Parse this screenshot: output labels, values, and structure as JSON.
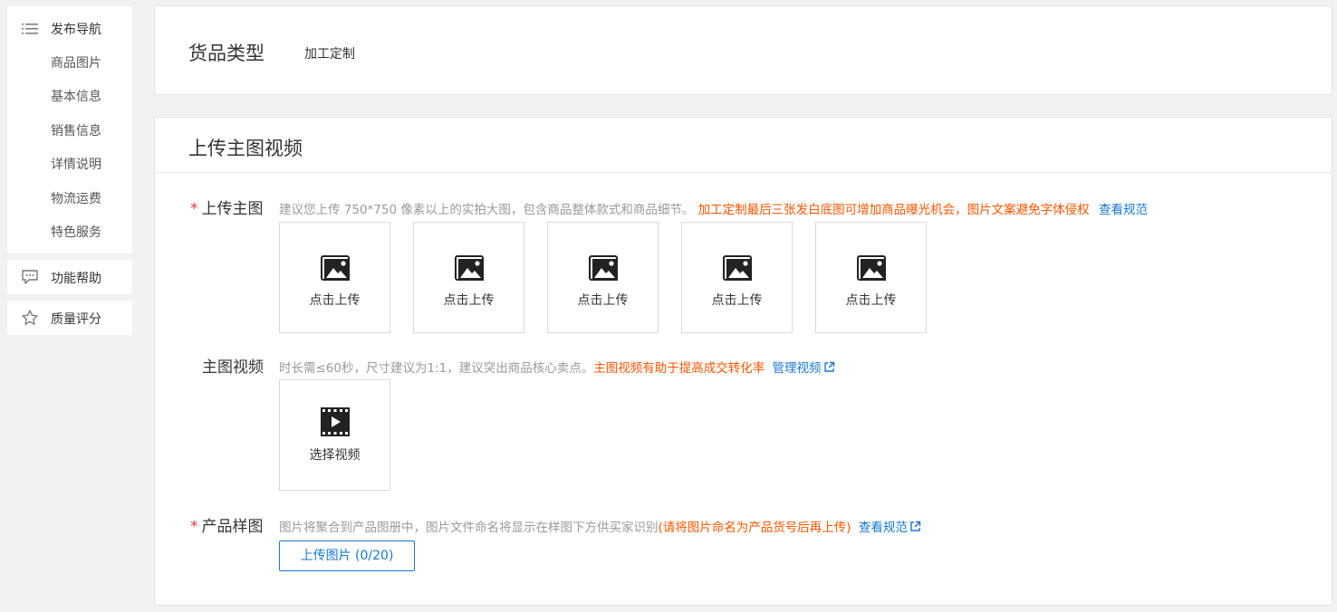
{
  "sidebar": {
    "nav_title": "发布导航",
    "nav_items": [
      {
        "label": "商品图片"
      },
      {
        "label": "基本信息"
      },
      {
        "label": "销售信息"
      },
      {
        "label": "详情说明"
      },
      {
        "label": "物流运费"
      },
      {
        "label": "特色服务"
      }
    ],
    "help_label": "功能帮助",
    "quality_label": "质量评分"
  },
  "goods_type": {
    "title": "货品类型",
    "value": "加工定制"
  },
  "media": {
    "title": "上传主图视频",
    "main_image": {
      "required_mark": "*",
      "label": "上传主图",
      "hint": "建议您上传 750*750 像素以上的实拍大图，包含商品整体款式和商品细节。",
      "warning": "加工定制最后三张发白底图可增加商品曝光机会，图片文案避免字体侵权",
      "link": "查看规范",
      "slots": [
        {
          "label": "点击上传"
        },
        {
          "label": "点击上传"
        },
        {
          "label": "点击上传"
        },
        {
          "label": "点击上传"
        },
        {
          "label": "点击上传"
        }
      ]
    },
    "main_video": {
      "label": "主图视频",
      "hint": "时长需≤60秒，尺寸建议为1:1，建议突出商品核心卖点。",
      "warning": "主图视频有助于提高成交转化率",
      "link": "管理视频",
      "select_label": "选择视频"
    },
    "sample_image": {
      "required_mark": "*",
      "label": "产品样图",
      "hint": "图片将聚合到产品图册中，图片文件命名将显示在样图下方供买家识别",
      "warning": "(请将图片命名为产品货号后再上传)",
      "link": "查看规范",
      "button": "上传图片 (0/20)"
    }
  },
  "colors": {
    "required": "#e4393c",
    "warning": "#ff5500",
    "link": "#1677d2"
  }
}
